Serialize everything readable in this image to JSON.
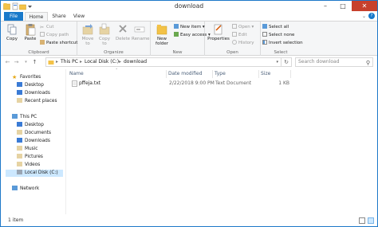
{
  "window": {
    "title": "download"
  },
  "tabs": [
    "File",
    "Home",
    "Share",
    "View"
  ],
  "ribbon": {
    "clipboard": {
      "label": "Clipboard",
      "copy": "Copy",
      "paste": "Paste",
      "cut": "Cut",
      "copy_path": "Copy path",
      "paste_shortcut": "Paste shortcut"
    },
    "organize": {
      "label": "Organize",
      "move_to": "Move to",
      "copy_to": "Copy to",
      "delete": "Delete",
      "rename": "Rename"
    },
    "new": {
      "label": "New",
      "new_folder": "New folder",
      "new_item": "New item",
      "easy_access": "Easy access"
    },
    "open": {
      "label": "Open",
      "properties": "Properties",
      "open": "Open",
      "edit": "Edit",
      "history": "History"
    },
    "select": {
      "label": "Select",
      "select_all": "Select all",
      "select_none": "Select none",
      "invert_selection": "Invert selection"
    }
  },
  "address": {
    "path": [
      "This PC",
      "Local Disk (C:)",
      "download"
    ],
    "search_placeholder": "Search download"
  },
  "navpane": {
    "favorites": {
      "label": "Favorites",
      "items": [
        "Desktop",
        "Downloads",
        "Recent places"
      ]
    },
    "this_pc": {
      "label": "This PC",
      "items": [
        "Desktop",
        "Documents",
        "Downloads",
        "Music",
        "Pictures",
        "Videos",
        "Local Disk (C:)"
      ]
    },
    "network": "Network"
  },
  "columns": [
    "Name",
    "Date modified",
    "Type",
    "Size"
  ],
  "files": [
    {
      "name": "pffeja.txt",
      "date": "2/22/2018 9:00 PM",
      "type": "Text Document",
      "size": "1 KB"
    }
  ],
  "status": {
    "count": "1 item"
  },
  "colors": {
    "accent": "#1979ca",
    "close": "#c7402c",
    "selection": "#cce8ff",
    "folder": "#f3c247"
  }
}
